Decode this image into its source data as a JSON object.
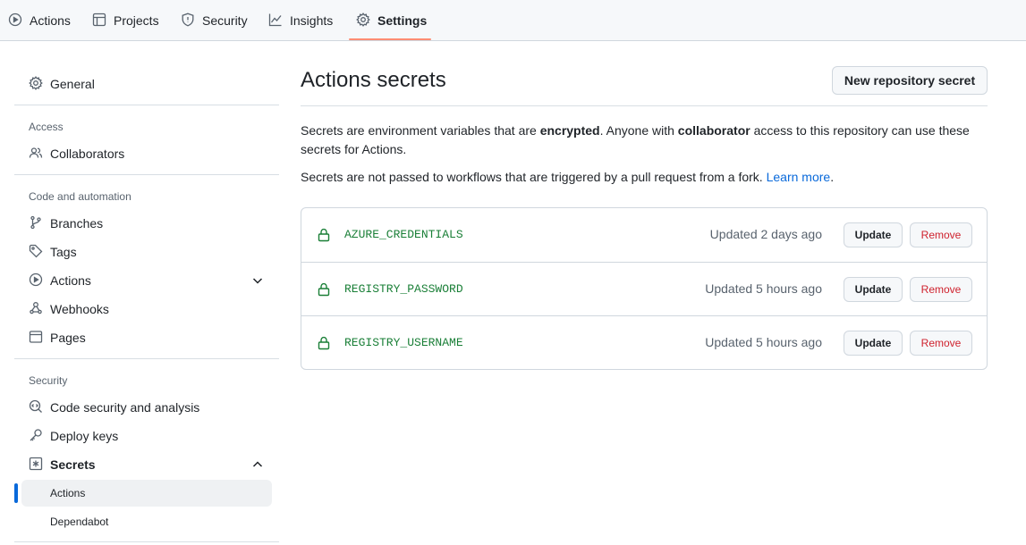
{
  "topnav": {
    "tabs": [
      {
        "label": "Actions",
        "icon": "play-circle-icon"
      },
      {
        "label": "Projects",
        "icon": "table-icon"
      },
      {
        "label": "Security",
        "icon": "shield-icon"
      },
      {
        "label": "Insights",
        "icon": "graph-icon"
      },
      {
        "label": "Settings",
        "icon": "gear-icon",
        "selected": true
      }
    ]
  },
  "sidebar": {
    "general": "General",
    "access_heading": "Access",
    "collaborators": "Collaborators",
    "code_heading": "Code and automation",
    "branches": "Branches",
    "tags": "Tags",
    "actions": "Actions",
    "webhooks": "Webhooks",
    "pages": "Pages",
    "security_heading": "Security",
    "code_security": "Code security and analysis",
    "deploy_keys": "Deploy keys",
    "secrets": "Secrets",
    "secrets_sub": [
      {
        "label": "Actions",
        "active": true
      },
      {
        "label": "Dependabot"
      }
    ]
  },
  "main": {
    "title": "Actions secrets",
    "new_button": "New repository secret",
    "para1_a": "Secrets are environment variables that are ",
    "para1_b": "encrypted",
    "para1_c": ". Anyone with ",
    "para1_d": "collaborator",
    "para1_e": " access to this repository can use these secrets for Actions.",
    "para2_a": "Secrets are not passed to workflows that are triggered by a pull request from a fork. ",
    "para2_link": "Learn more",
    "para2_end": ".",
    "secrets": [
      {
        "name": "AZURE_CREDENTIALS",
        "updated": "Updated 2 days ago",
        "update": "Update",
        "remove": "Remove"
      },
      {
        "name": "REGISTRY_PASSWORD",
        "updated": "Updated 5 hours ago",
        "update": "Update",
        "remove": "Remove"
      },
      {
        "name": "REGISTRY_USERNAME",
        "updated": "Updated 5 hours ago",
        "update": "Update",
        "remove": "Remove"
      }
    ]
  },
  "colors": {
    "accent_underline": "#fd8c73",
    "link": "#0969da",
    "secret_green": "#1a7f37",
    "danger": "#cf222e"
  }
}
